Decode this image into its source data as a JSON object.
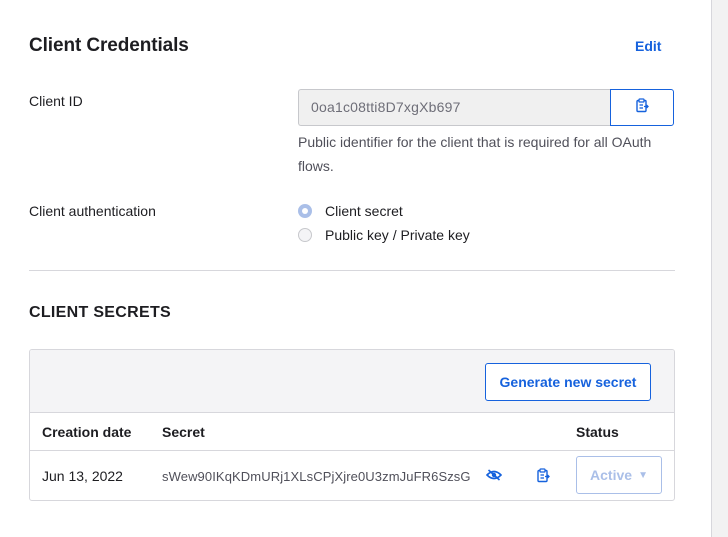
{
  "header": {
    "title": "Client Credentials",
    "edit_label": "Edit"
  },
  "client_id": {
    "label": "Client ID",
    "value": "0oa1c08tti8D7xgXb697",
    "help": "Public identifier for the client that is required for all OAuth flows.",
    "copy_icon": "clipboard-icon"
  },
  "client_auth": {
    "label": "Client authentication",
    "options": [
      {
        "label": "Client secret",
        "checked": true
      },
      {
        "label": "Public key / Private key",
        "checked": false
      }
    ]
  },
  "secrets": {
    "title": "CLIENT SECRETS",
    "generate_label": "Generate new secret",
    "columns": [
      "Creation date",
      "Secret",
      "Status"
    ],
    "rows": [
      {
        "date": "Jun 13, 2022",
        "secret": "sWew90IKqKDmURj1XLsCPjXjre0U3zmJuFR6SzsG",
        "status": "Active",
        "reveal_icon": "eye-hidden-icon",
        "copy_icon": "clipboard-icon"
      }
    ]
  },
  "colors": {
    "accent": "#1662dd",
    "disabled_accent": "#aabfe8",
    "muted_bg": "#f4f4f6",
    "border": "#d7d7dc"
  }
}
